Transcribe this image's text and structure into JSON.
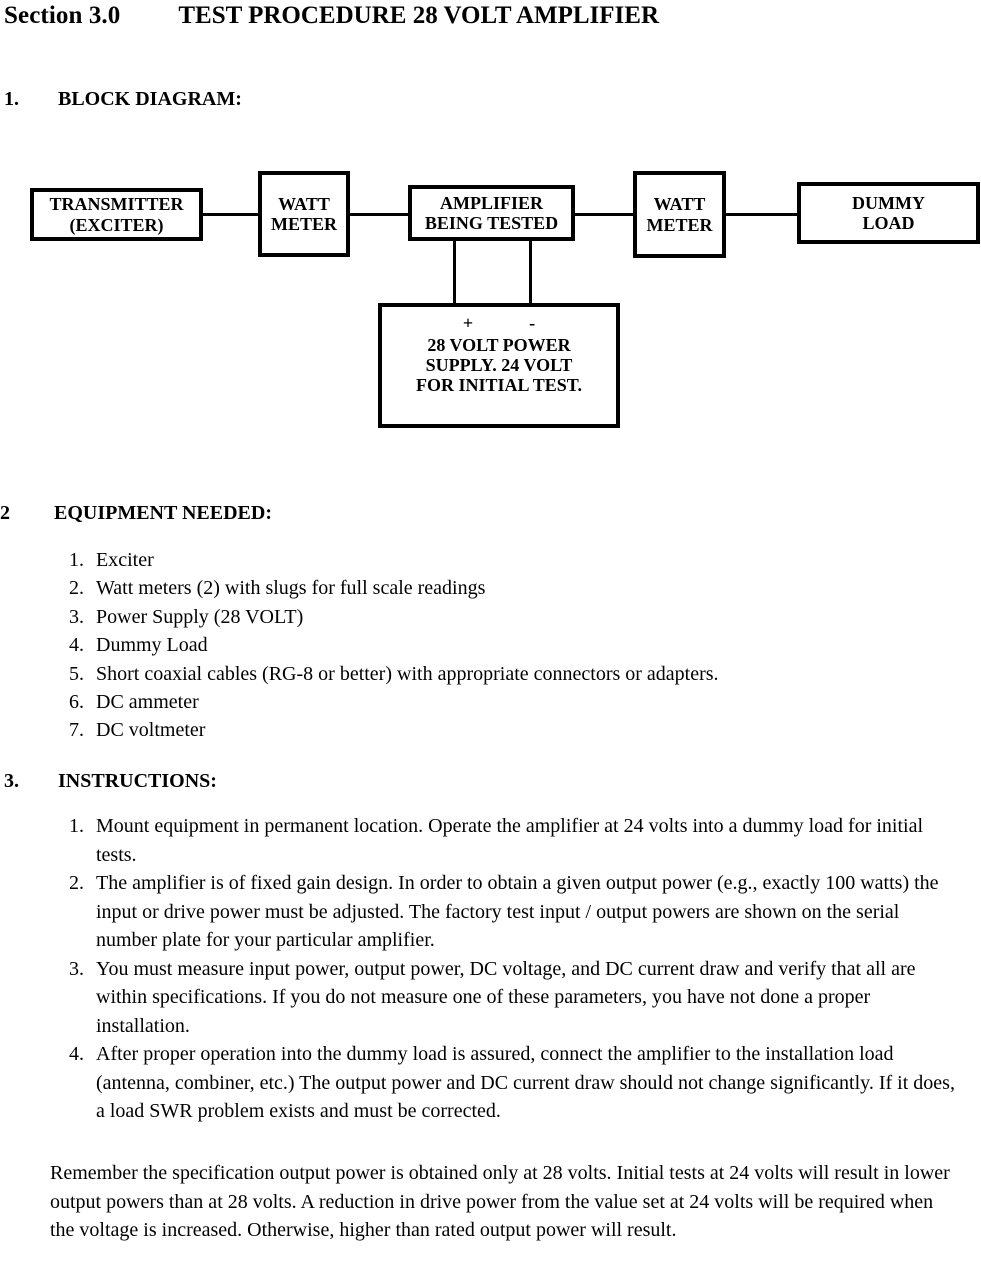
{
  "header": {
    "section_label": "Section 3.0",
    "section_title": "TEST PROCEDURE 28 VOLT AMPLIFIER"
  },
  "sections": {
    "block_diagram": {
      "number": "1.",
      "title": "BLOCK DIAGRAM:"
    },
    "equipment": {
      "number": "2",
      "title": "EQUIPMENT NEEDED:"
    },
    "instructions": {
      "number": "3.",
      "title": "INSTRUCTIONS:"
    }
  },
  "diagram": {
    "nodes": {
      "transmitter": {
        "line1": "TRANSMITTER",
        "line2": "(EXCITER)"
      },
      "watt_meter_1": {
        "line1": "WATT",
        "line2": "METER"
      },
      "amplifier": {
        "line1": "AMPLIFIER",
        "line2": "BEING TESTED"
      },
      "watt_meter_2": {
        "line1": "WATT",
        "line2": "METER"
      },
      "dummy_load": {
        "line1": "DUMMY",
        "line2": "LOAD"
      },
      "power_supply": {
        "positive": "+",
        "negative": "-",
        "line1": "28 VOLT POWER",
        "line2": "SUPPLY. 24 VOLT",
        "line3": "FOR INITIAL TEST."
      }
    }
  },
  "equipment_items": [
    {
      "marker": "1.",
      "text": "Exciter"
    },
    {
      "marker": "2.",
      "text": "Watt meters (2) with slugs for full scale readings"
    },
    {
      "marker": "3.",
      "text": "Power Supply (28 VOLT)"
    },
    {
      "marker": "4.",
      "text": "Dummy Load"
    },
    {
      "marker": "5.",
      "text": "Short coaxial cables (RG-8 or better) with appropriate connectors or adapters."
    },
    {
      "marker": "6.",
      "text": "DC ammeter"
    },
    {
      "marker": "7.",
      "text": "DC voltmeter"
    }
  ],
  "instruction_items": [
    {
      "marker": "1.",
      "text": "Mount equipment in permanent location. Operate the amplifier at 24 volts into a dummy load for initial tests."
    },
    {
      "marker": "2.",
      "text": "The amplifier is of fixed gain design. In order to obtain a given output power (e.g., exactly 100 watts) the input or drive power must be adjusted. The factory test input / output powers are shown on the serial number plate for your particular amplifier."
    },
    {
      "marker": "3.",
      "text": "You must measure input power, output power, DC voltage, and DC current draw and verify that all are within specifications. If you do not measure one of these parameters, you have not done a proper installation."
    },
    {
      "marker": "4.",
      "text": "After proper operation into the dummy load is assured, connect the amplifier to the installation load (antenna, combiner, etc.) The output power and DC current draw should not change significantly. If it does, a load SWR problem exists and must be corrected."
    }
  ],
  "closing_paragraph": "Remember the specification output power is obtained only at 28 volts. Initial tests at 24 volts will result in lower output powers than at 28 volts. A reduction in drive power from the value set at 24 volts will be required when the voltage is increased. Otherwise, higher than rated output power will result."
}
